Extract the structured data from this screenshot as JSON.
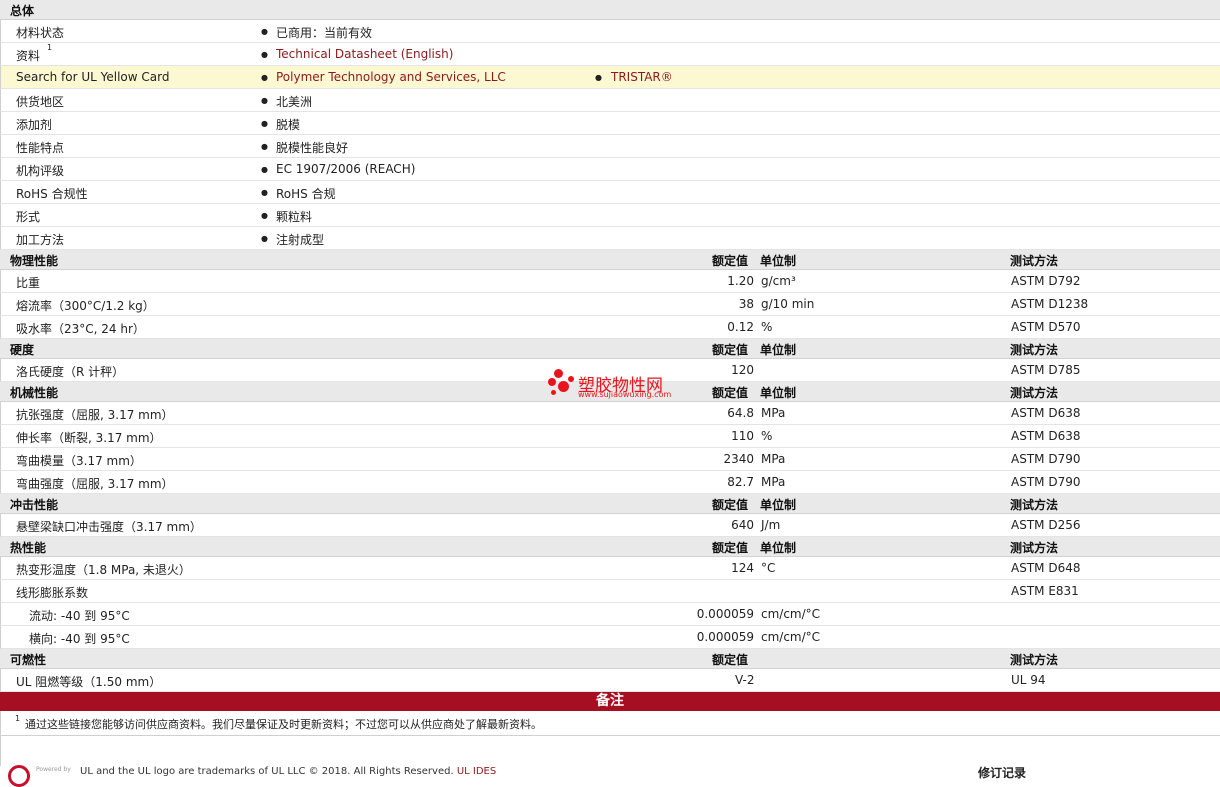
{
  "general": {
    "title": "总体",
    "rows": [
      {
        "label": "材料状态",
        "items": [
          "已商用：当前有效"
        ],
        "link": false
      },
      {
        "label": "资料",
        "sup": "1",
        "items": [
          "Technical Datasheet (English)"
        ],
        "link": true
      },
      {
        "label": "Search for UL Yellow Card",
        "items": [
          "Polymer Technology and Services, LLC",
          "TRISTAR®"
        ],
        "link": true,
        "highlight": true
      },
      {
        "label": "供货地区",
        "items": [
          "北美洲"
        ],
        "link": false
      },
      {
        "label": "添加剂",
        "items": [
          "脱模"
        ],
        "link": false
      },
      {
        "label": "性能特点",
        "items": [
          "脱模性能良好"
        ],
        "link": false
      },
      {
        "label": "机构评级",
        "items": [
          "EC 1907/2006 (REACH)"
        ],
        "link": false
      },
      {
        "label": "RoHS 合规性",
        "items": [
          "RoHS 合规"
        ],
        "link": false
      },
      {
        "label": "形式",
        "items": [
          "颗粒料"
        ],
        "link": false
      },
      {
        "label": "加工方法",
        "items": [
          "注射成型"
        ],
        "link": false
      }
    ]
  },
  "headers": {
    "value": "额定值",
    "unit": "单位制",
    "method": "测试方法"
  },
  "sections": [
    {
      "title": "物理性能",
      "show_unit": true,
      "rows": [
        {
          "label": "比重",
          "value": "1.20",
          "unit": "g/cm³",
          "method": "ASTM D792"
        },
        {
          "label": "熔流率（300°C/1.2 kg）",
          "value": "38",
          "unit": "g/10 min",
          "method": "ASTM D1238"
        },
        {
          "label": "吸水率（23°C, 24 hr）",
          "value": "0.12",
          "unit": "%",
          "method": "ASTM D570"
        }
      ]
    },
    {
      "title": "硬度",
      "show_unit": true,
      "rows": [
        {
          "label": "洛氏硬度（R 计秤）",
          "value": "120",
          "unit": "",
          "method": "ASTM D785"
        }
      ]
    },
    {
      "title": "机械性能",
      "show_unit": true,
      "rows": [
        {
          "label": "抗张强度（屈服, 3.17 mm）",
          "value": "64.8",
          "unit": "MPa",
          "method": "ASTM D638"
        },
        {
          "label": "伸长率（断裂, 3.17 mm）",
          "value": "110",
          "unit": "%",
          "method": "ASTM D638"
        },
        {
          "label": "弯曲模量（3.17 mm）",
          "value": "2340",
          "unit": "MPa",
          "method": "ASTM D790"
        },
        {
          "label": "弯曲强度（屈服, 3.17 mm）",
          "value": "82.7",
          "unit": "MPa",
          "method": "ASTM D790"
        }
      ]
    },
    {
      "title": "冲击性能",
      "show_unit": true,
      "rows": [
        {
          "label": "悬壁梁缺口冲击强度（3.17 mm）",
          "value": "640",
          "unit": "J/m",
          "method": "ASTM D256"
        }
      ]
    },
    {
      "title": "热性能",
      "show_unit": true,
      "rows": [
        {
          "label": "热变形温度（1.8 MPa, 未退火）",
          "value": "124",
          "unit": "°C",
          "method": "ASTM D648"
        },
        {
          "label": "线形膨胀系数",
          "value": "",
          "unit": "",
          "method": "ASTM E831"
        },
        {
          "label": "流动: -40 到  95°C",
          "value": "0.000059",
          "unit": "cm/cm/°C",
          "method": "",
          "sub": true
        },
        {
          "label": "横向: -40 到  95°C",
          "value": "0.000059",
          "unit": "cm/cm/°C",
          "method": "",
          "sub": true
        }
      ]
    },
    {
      "title": "可燃性",
      "show_unit": false,
      "rows": [
        {
          "label": "UL 阻燃等级（1.50 mm）",
          "value": "V-2",
          "unit": "",
          "method": "UL 94",
          "center_value": true
        }
      ]
    }
  ],
  "notes": {
    "title": "备注",
    "items": [
      {
        "sup": "1",
        "text": "通过这些链接您能够访问供应商资料。我们尽量保证及时更新资料；不过您可以从供应商处了解最新资料。"
      }
    ]
  },
  "footer": {
    "powered": "Powered by",
    "trademark": "UL and the UL logo are trademarks of UL LLC © 2018. All Rights Reserved.",
    "ul_link": "UL IDES",
    "revision": "修订记录"
  },
  "watermark": {
    "title": "塑胶物性网",
    "url": "www.sujiaowuxing.com"
  },
  "colors": {
    "link": "#8b1a1a",
    "notes_bar": "#a50f21",
    "highlight": "#fbf8d2",
    "section_bg": "#e9e9e9",
    "watermark": "#e8141b"
  }
}
